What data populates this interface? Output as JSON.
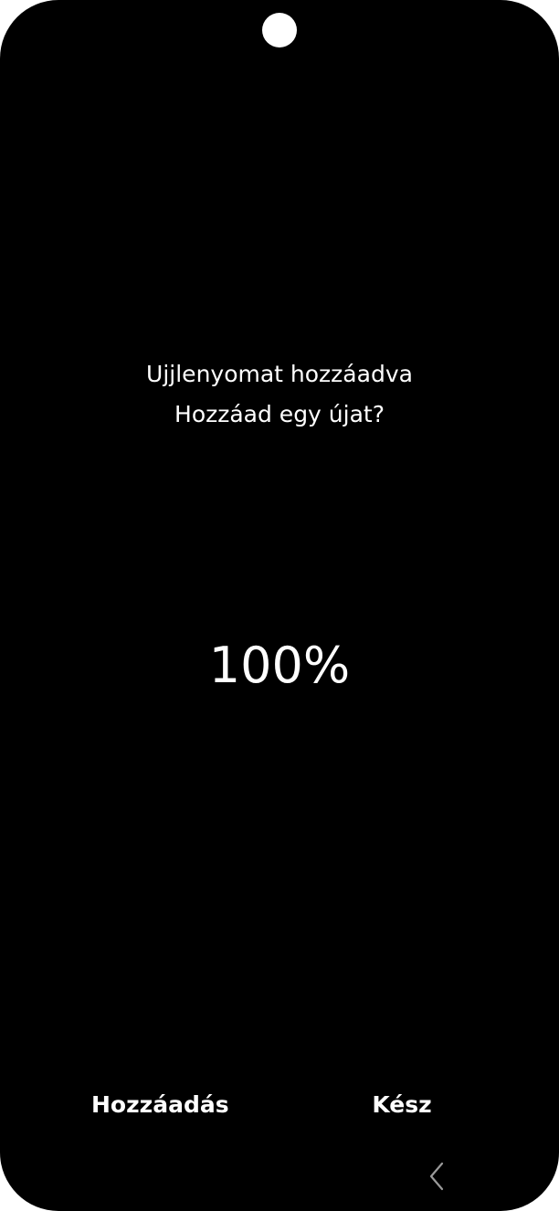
{
  "message": {
    "line1": "Ujjlenyomat hozzáadva",
    "line2": "Hozzáad egy újat?"
  },
  "progress": {
    "label": "100%",
    "value": 100
  },
  "actions": {
    "add_label": "Hozzáadás",
    "done_label": "Kész"
  },
  "navbar": {
    "back_icon": "back-chevron-icon"
  },
  "colors": {
    "background": "#000000",
    "text": "#ffffff",
    "nav_icon": "#9a9a9a"
  }
}
